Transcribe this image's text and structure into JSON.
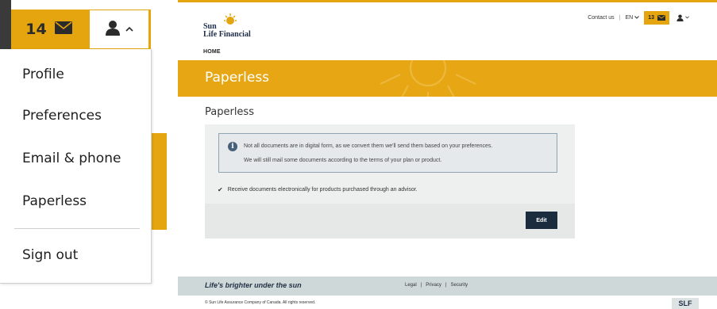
{
  "zoom": {
    "message_count": "14",
    "menu_items": [
      "Profile",
      "Preferences",
      "Email & phone",
      "Paperless"
    ],
    "sign_out": "Sign out"
  },
  "header": {
    "logo_line1": "Sun",
    "logo_line2": "Life Financial",
    "contact_us": "Contact us",
    "lang": "EN",
    "message_count": "13",
    "nav_home": "HOME"
  },
  "banner": {
    "title": "Paperless"
  },
  "main": {
    "section_title": "Paperless",
    "info_line1": "Not all documents are in digital form, as we convert them we'll send them based on your preferences.",
    "info_line2": "We will still mail some documents according to the terms of your plan or product.",
    "checked_item": "Receive documents electronically for products purchased through an advisor.",
    "edit_label": "Edit"
  },
  "footer": {
    "tagline": "Life's brighter under the sun",
    "links": [
      "Legal",
      "Privacy",
      "Security"
    ],
    "copyright": "© Sun Life Assurance Company of Canada. All rights reserved.",
    "badge": "SLF"
  },
  "colors": {
    "accent": "#e4a50e",
    "dark_button": "#1c2c3f",
    "footer_bg": "#cfd8d8"
  },
  "icons": [
    "envelope-icon",
    "user-icon",
    "chevron-up-icon",
    "chevron-down-icon",
    "info-icon",
    "check-icon",
    "sun-logo-icon"
  ]
}
